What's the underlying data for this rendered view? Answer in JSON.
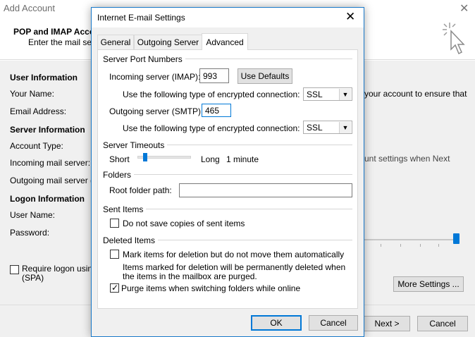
{
  "background_window": {
    "title": "Add Account",
    "heading": "POP and IMAP Acco",
    "subheading": "Enter the mail serv",
    "sections": {
      "user_information": "User Information",
      "server_information": "Server Information",
      "logon_information": "Logon Information"
    },
    "labels": {
      "your_name": "Your Name:",
      "email_address": "Email Address:",
      "account_type": "Account Type:",
      "incoming_mail_server": "Incoming mail server:",
      "outgoing_mail_server": "Outgoing mail server (",
      "user_name": "User Name:",
      "password": "Password:"
    },
    "right_text_1": "your account to ensure that",
    "right_text_2": "unt settings when Next",
    "require_logon_line1": "Require logon usin",
    "require_logon_line2": "(SPA)",
    "more_settings_button": "More Settings ...",
    "next_button": "Next >",
    "cancel_button": "Cancel",
    "accent_color": "#0078d7"
  },
  "dialog": {
    "title": "Internet E-mail Settings",
    "tabs": [
      {
        "label": "General",
        "active": false
      },
      {
        "label": "Outgoing Server",
        "active": false
      },
      {
        "label": "Advanced",
        "active": true
      }
    ],
    "server_port_numbers": {
      "group_label": "Server Port Numbers",
      "incoming_label": "Incoming server (IMAP):",
      "incoming_value": "993",
      "use_defaults_button": "Use Defaults",
      "incoming_encryption_label": "Use the following type of encrypted connection:",
      "incoming_encryption_value": "SSL",
      "outgoing_label": "Outgoing server (SMTP):",
      "outgoing_value": "465",
      "outgoing_encryption_label": "Use the following type of encrypted connection:",
      "outgoing_encryption_value": "SSL"
    },
    "server_timeouts": {
      "group_label": "Server Timeouts",
      "short_label": "Short",
      "long_label": "Long",
      "value_label": "1 minute",
      "slider_level": 0.05
    },
    "folders": {
      "group_label": "Folders",
      "root_folder_label": "Root folder path:",
      "root_folder_value": ""
    },
    "sent_items": {
      "group_label": "Sent Items",
      "do_not_save_label": "Do not save copies of sent items",
      "do_not_save_checked": false
    },
    "deleted_items": {
      "group_label": "Deleted Items",
      "mark_for_deletion_label": "Mark items for deletion but do not move them automatically",
      "mark_for_deletion_checked": false,
      "note_line1": "Items marked for deletion will be permanently deleted when",
      "note_line2": "the items in the mailbox are purged.",
      "purge_label": "Purge items when switching folders while online",
      "purge_checked": true
    },
    "ok_button": "OK",
    "cancel_button": "Cancel"
  }
}
